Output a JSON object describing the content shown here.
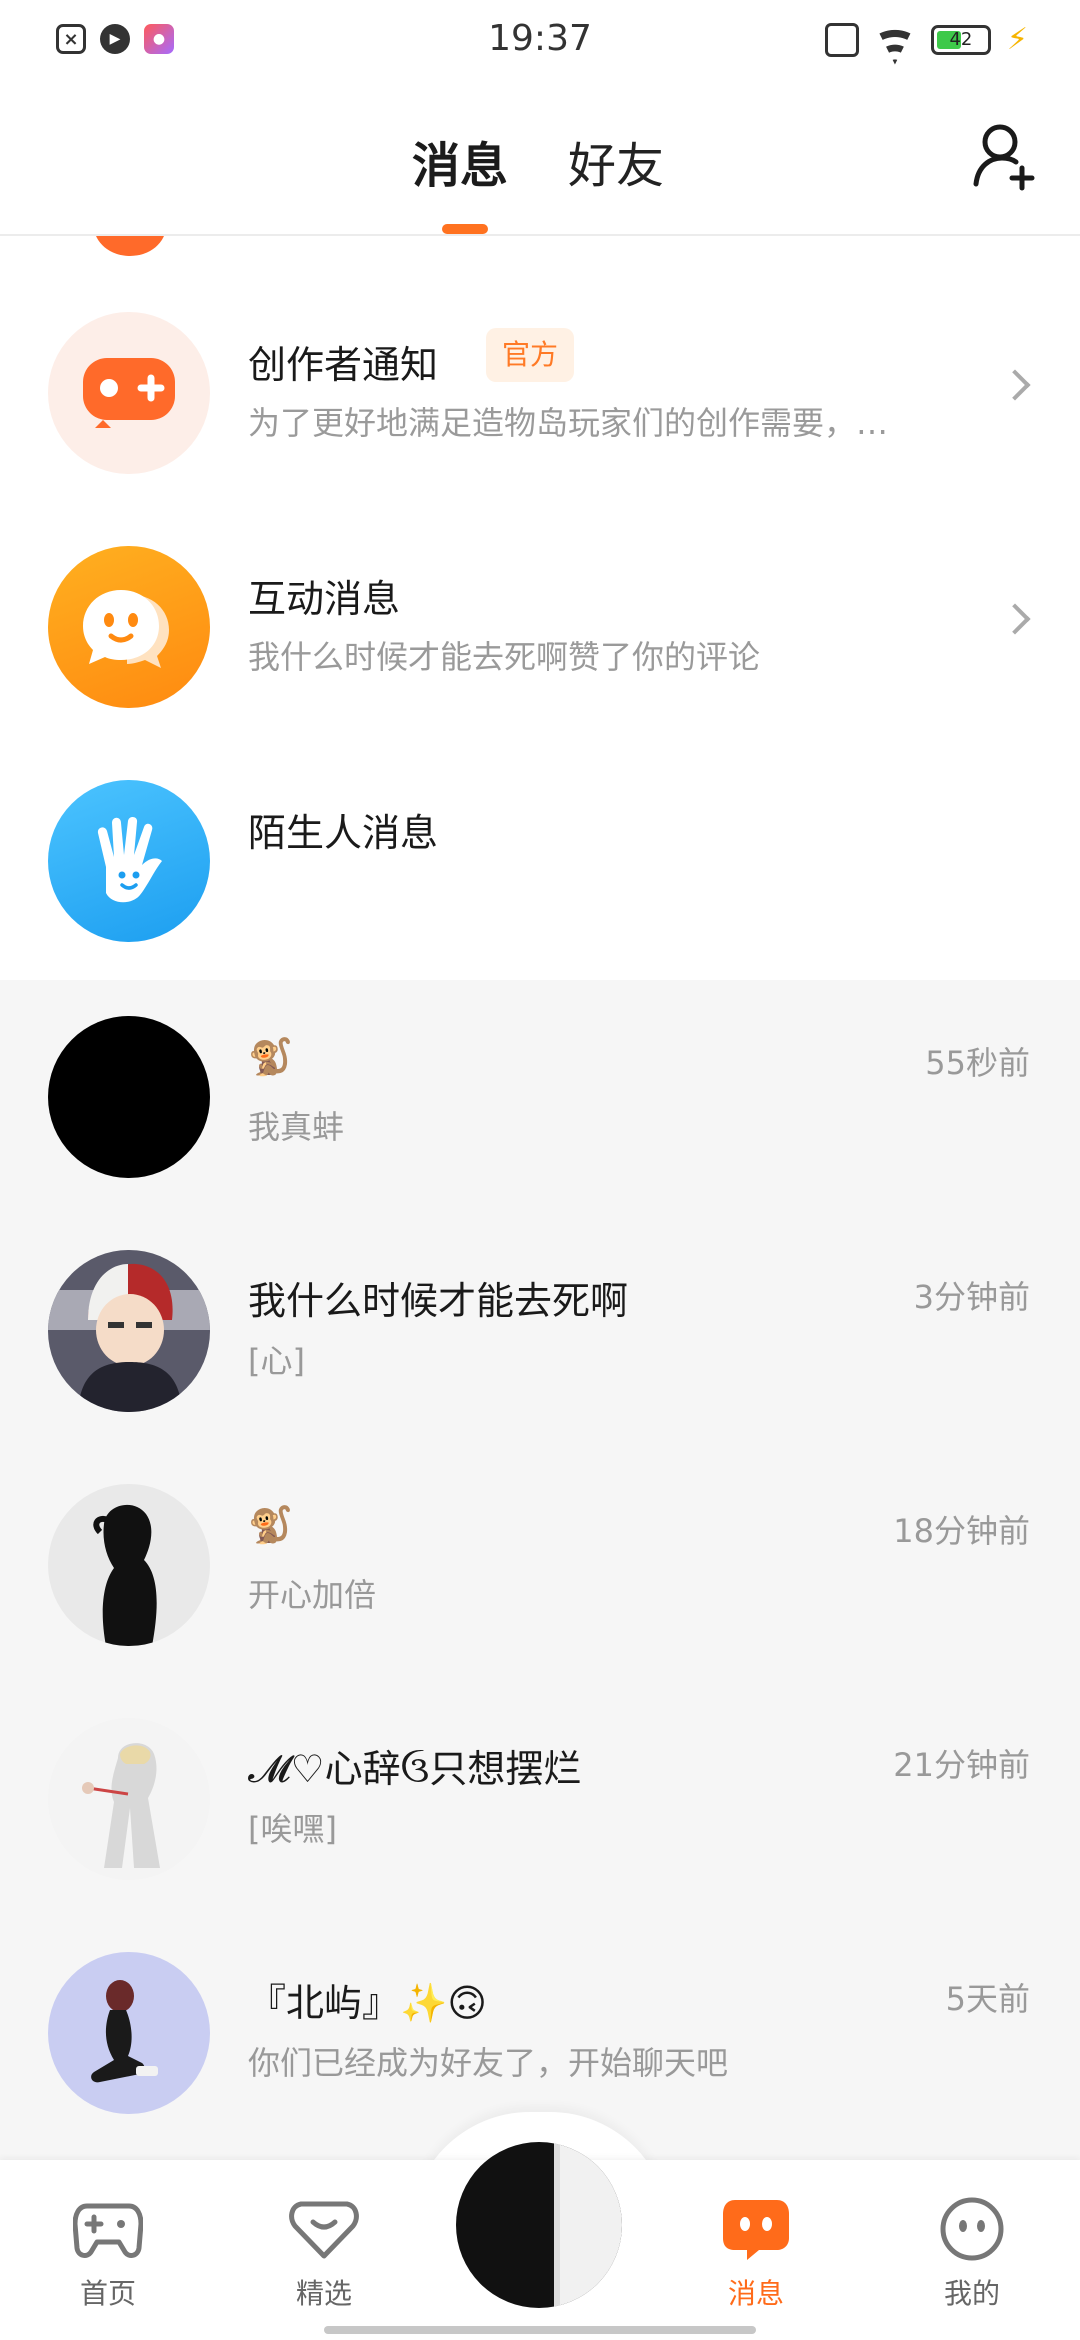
{
  "status": {
    "time": "19:37",
    "battery": "42"
  },
  "header": {
    "tab_messages": "消息",
    "tab_friends": "好友"
  },
  "system": [
    {
      "title": "创作者通知",
      "badge": "官方",
      "desc": "为了更好地满足造物岛玩家们的创作需要，…"
    },
    {
      "title": "互动消息",
      "desc": "我什么时候才能去死啊赞了你的评论"
    },
    {
      "title": "陌生人消息"
    }
  ],
  "conversations": [
    {
      "name": "🐒",
      "message": "我真蚌",
      "time": "55秒前"
    },
    {
      "name": "我什么时候才能去死啊",
      "message": "[心]",
      "time": "3分钟前"
    },
    {
      "name": "🐒",
      "message": "开心加倍",
      "time": "18分钟前"
    },
    {
      "name": "𝓜♡心辞ઉ只想摆烂",
      "message": "[唉嘿]",
      "time": "21分钟前"
    },
    {
      "name": "『北屿』✨🙃",
      "message": "你们已经成为好友了，开始聊天吧",
      "time": "5天前"
    }
  ],
  "nav": {
    "home": "首页",
    "featured": "精选",
    "messages": "消息",
    "mine": "我的"
  },
  "colors": {
    "accent": "#ff7220",
    "creator_icon": "#ff6a2a",
    "interaction_icon": "#ff9a12",
    "stranger_icon": "#2eaaf0"
  }
}
